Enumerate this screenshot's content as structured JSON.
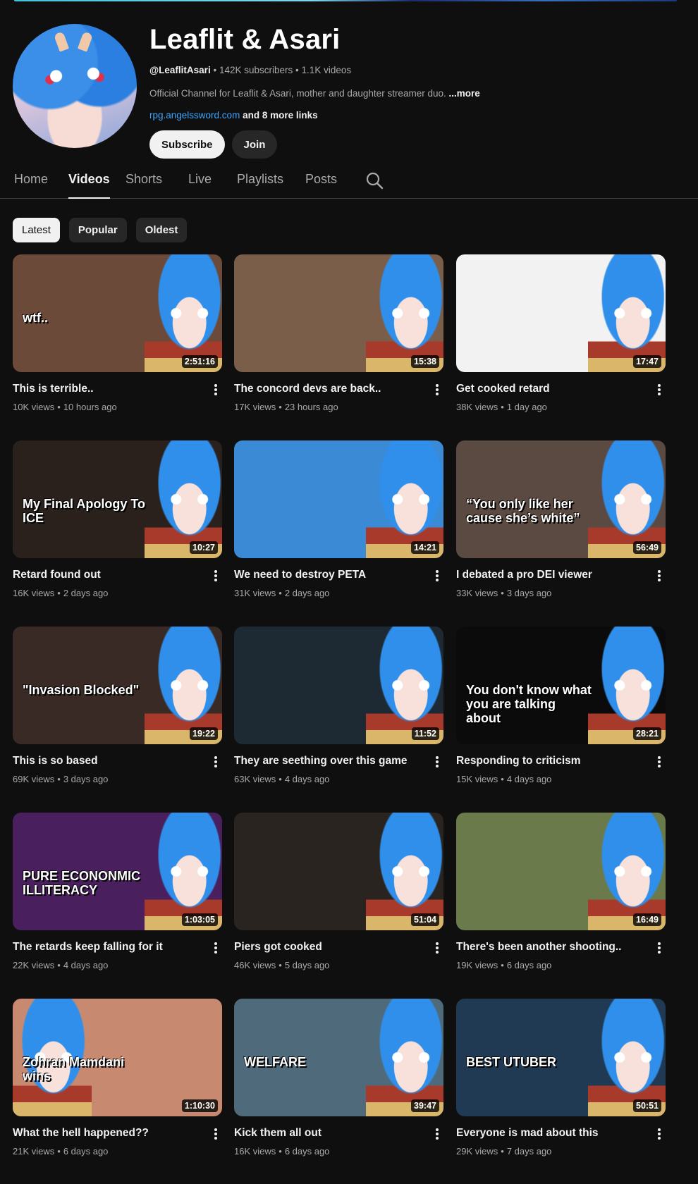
{
  "channel": {
    "name": "Leaflit & Asari",
    "handle": "@LeaflitAsari",
    "subscribers": "142K subscribers",
    "videos_count": "1.1K videos",
    "separator": "•",
    "description": "Official Channel for Leaflit & Asari, mother and daughter streamer duo.",
    "more_label": "...more",
    "link": "rpg.angelssword.com",
    "more_links": "and 8 more links",
    "subscribe_label": "Subscribe",
    "join_label": "Join"
  },
  "tabs": [
    {
      "label": "Home",
      "active": false
    },
    {
      "label": "Videos",
      "active": true
    },
    {
      "label": "Shorts",
      "active": false
    },
    {
      "label": "Live",
      "active": false
    },
    {
      "label": "Playlists",
      "active": false
    },
    {
      "label": "Posts",
      "active": false
    }
  ],
  "chips": [
    {
      "label": "Latest",
      "active": true
    },
    {
      "label": "Popular",
      "active": false
    },
    {
      "label": "Oldest",
      "active": false
    }
  ],
  "videos": [
    {
      "title": "This is terrible..",
      "views": "10K views",
      "age": "10 hours ago",
      "duration": "2:51:16",
      "overlay": "wtf..",
      "bg": "#6b4a3a"
    },
    {
      "title": "The concord devs are back..",
      "views": "17K views",
      "age": "23 hours ago",
      "duration": "15:38",
      "overlay": "",
      "bg": "#7a5e4a"
    },
    {
      "title": "Get cooked retard",
      "views": "38K views",
      "age": "1 day ago",
      "duration": "17:47",
      "overlay": "",
      "bg": "#f2f2f2"
    },
    {
      "title": "Retard found out",
      "views": "16K views",
      "age": "2 days ago",
      "duration": "10:27",
      "overlay": "My Final Apology To ICE",
      "bg": "#2a211c"
    },
    {
      "title": "We need to destroy PETA",
      "views": "31K views",
      "age": "2 days ago",
      "duration": "14:21",
      "overlay": "",
      "bg": "#3a8ad6"
    },
    {
      "title": "I debated a pro DEI viewer",
      "views": "33K views",
      "age": "3 days ago",
      "duration": "56:49",
      "overlay": "“You only like her cause she’s white”",
      "bg": "#5b4a42"
    },
    {
      "title": "This is so based",
      "views": "69K views",
      "age": "3 days ago",
      "duration": "19:22",
      "overlay": "\"Invasion Blocked\"",
      "bg": "#3a2a26"
    },
    {
      "title": "They are seething over this game",
      "views": "63K views",
      "age": "4 days ago",
      "duration": "11:52",
      "overlay": "",
      "bg": "#1e2a33"
    },
    {
      "title": "Responding to criticism",
      "views": "15K views",
      "age": "4 days ago",
      "duration": "28:21",
      "overlay": "You don't know what you are talking about",
      "bg": "#0b0b0b"
    },
    {
      "title": "The retards keep falling for it",
      "views": "22K views",
      "age": "4 days ago",
      "duration": "1:03:05",
      "overlay": "PURE ECONONMIC ILLITERACY",
      "bg": "#4a1f5e"
    },
    {
      "title": "Piers got cooked",
      "views": "46K views",
      "age": "5 days ago",
      "duration": "51:04",
      "overlay": "",
      "bg": "#2a2420"
    },
    {
      "title": "There's been another shooting..",
      "views": "19K views",
      "age": "6 days ago",
      "duration": "16:49",
      "overlay": "",
      "bg": "#6a7a4a"
    },
    {
      "title": "What the hell happened??",
      "views": "21K views",
      "age": "6 days ago",
      "duration": "1:10:30",
      "overlay": "Zohran Mamdani wins",
      "bg": "#c78a70"
    },
    {
      "title": "Kick them all out",
      "views": "16K views",
      "age": "6 days ago",
      "duration": "39:47",
      "overlay": "WELFARE",
      "bg": "#4f6a7a"
    },
    {
      "title": "Everyone is mad about this",
      "views": "29K views",
      "age": "7 days ago",
      "duration": "50:51",
      "overlay": "BEST UTUBER",
      "bg": "#1f3a52"
    }
  ]
}
